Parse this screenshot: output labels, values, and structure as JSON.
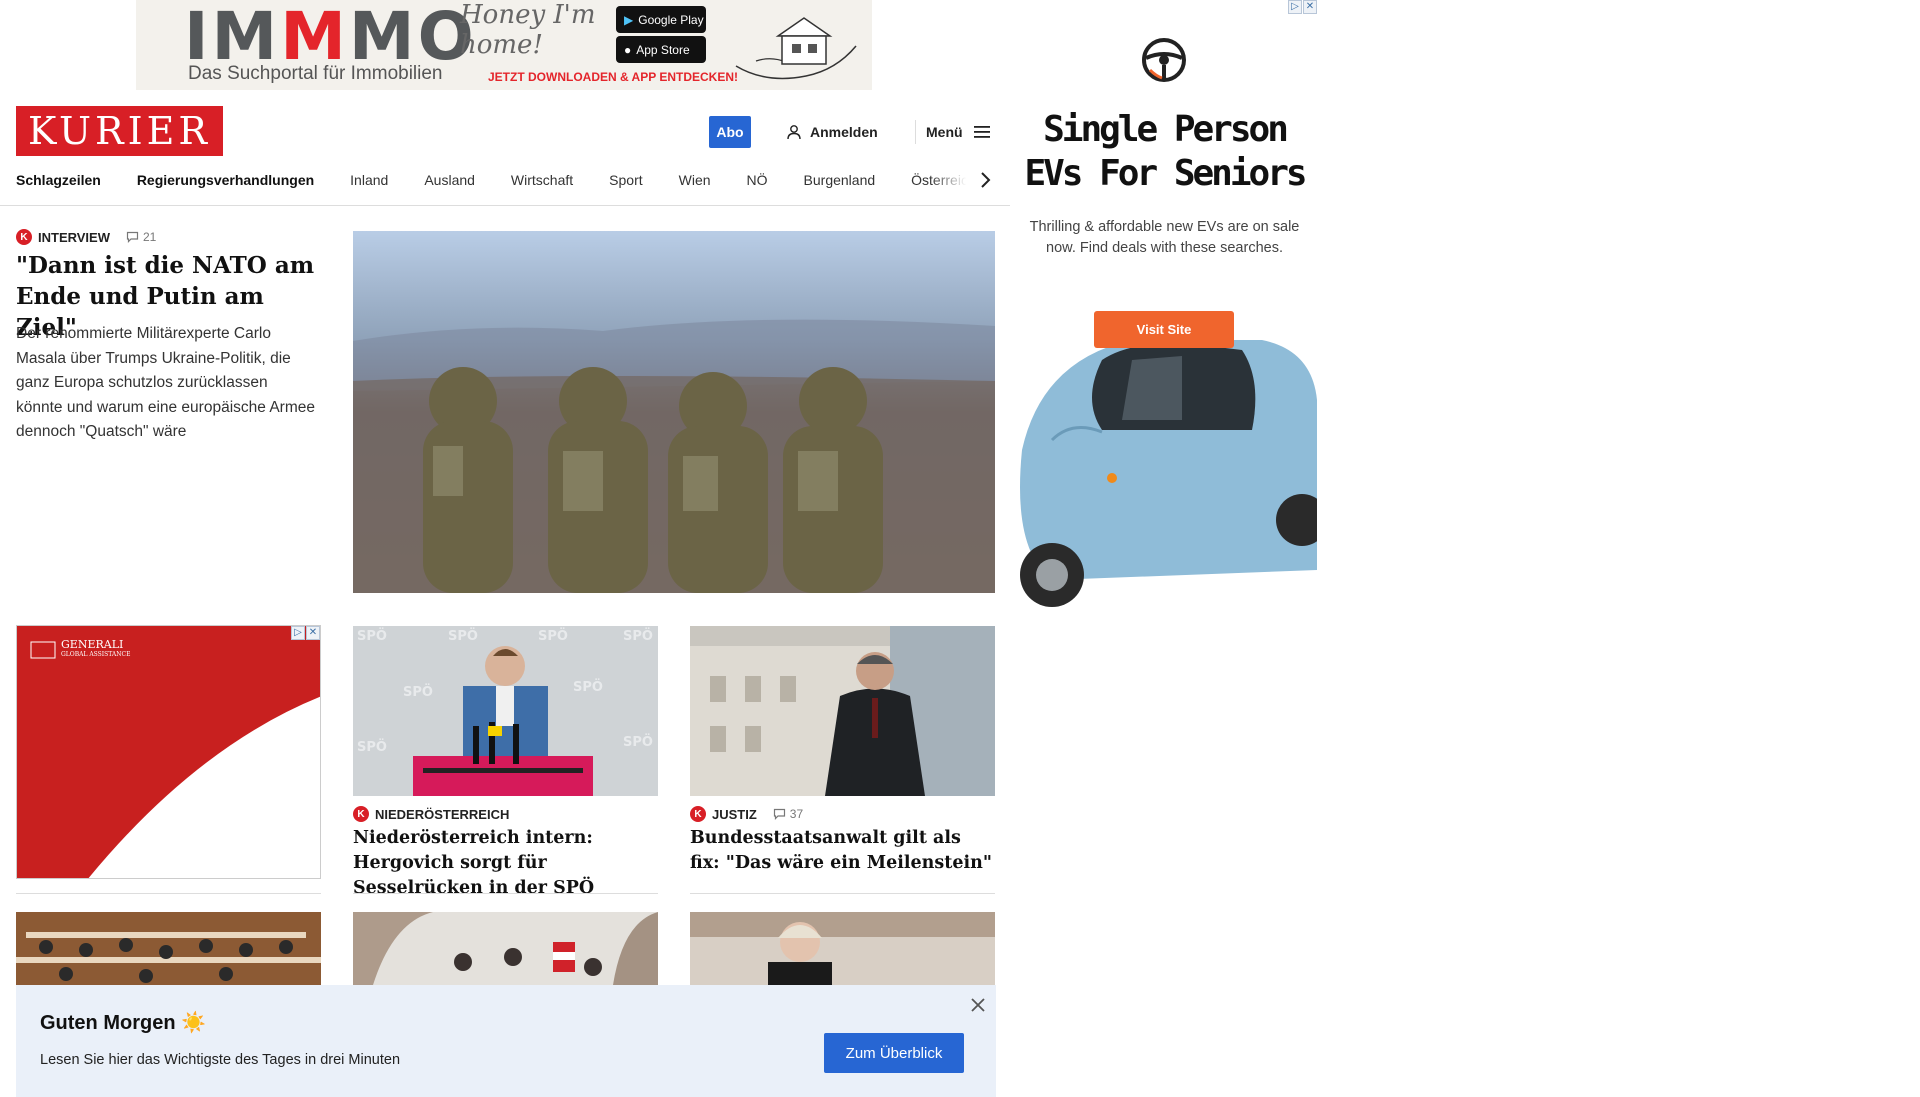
{
  "top_ad": {
    "brand_prefix": "IM",
    "brand_highlight": "M",
    "brand_suffix": "MO",
    "subtitle": "Das Suchportal für Immobilien",
    "slogan": "Honey I'm home!",
    "google_play": "Google Play",
    "app_store": "App Store",
    "cta": "JETZT DOWNLOADEN & APP ENTDECKEN!"
  },
  "header": {
    "logo": "KURIER",
    "abo": "Abo",
    "login": "Anmelden",
    "menu": "Menü"
  },
  "nav": [
    "Schlagzeilen",
    "Regierungsverhandlungen",
    "Inland",
    "Ausland",
    "Wirtschaft",
    "Sport",
    "Wien",
    "NÖ",
    "Burgenland",
    "Österreich"
  ],
  "lead": {
    "category": "INTERVIEW",
    "comments": "21",
    "title": "\"Dann ist die NATO am Ende und Putin am Ziel\"",
    "teaser": "Der renommierte Militärexperte Carlo Masala über Trumps Ukraine-Politik, die ganz Europa schutzlos zurücklassen könnte und warum eine europäische Armee dennoch \"Quatsch\" wäre"
  },
  "side_ad": {
    "brand": "GENERALI",
    "subline": "GLOBAL ASSISTANCE"
  },
  "cards": [
    {
      "category": "NIEDERÖSTERREICH",
      "comments": "",
      "title": "Niederösterreich intern: Hergovich sorgt für Sesselrücken in der SPÖ"
    },
    {
      "category": "JUSTIZ",
      "comments": "37",
      "title": "Bundesstaatsanwalt gilt als fix: \"Das wäre ein Meilenstein\""
    }
  ],
  "right_ad": {
    "headline": "Single Person EVs For Seniors",
    "copy": "Thrilling & affordable new EVs are on sale now. Find deals with these searches.",
    "button": "Visit Site"
  },
  "notification": {
    "title": "Guten Morgen ☀️",
    "text": "Lesen Sie hier das Wichtigste des Tages in drei Minuten",
    "button": "Zum Überblick"
  },
  "colors": {
    "brand_red": "#d81f26",
    "accent_blue": "#2766d3",
    "ad_orange": "#f0652d",
    "notification_bg": "#eaf0f9"
  }
}
